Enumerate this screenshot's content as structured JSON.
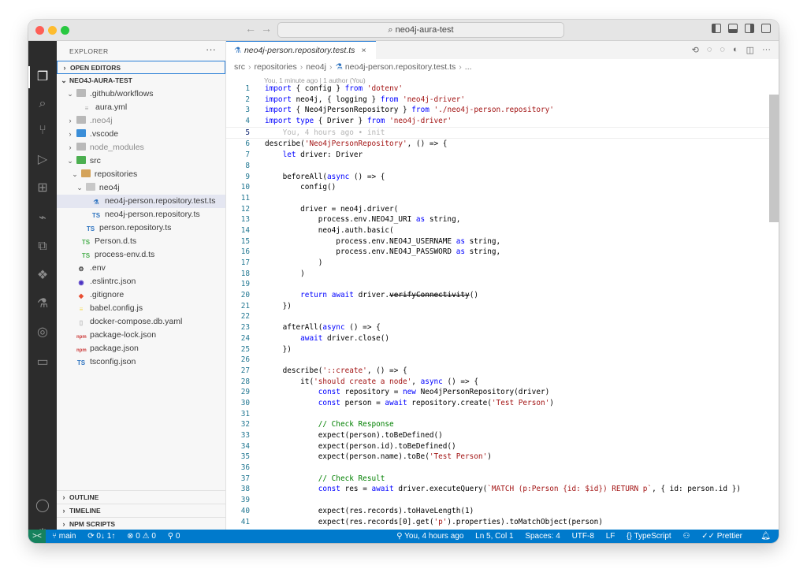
{
  "titlebar": {
    "search": "neo4j-aura-test",
    "back": "←",
    "forward": "→"
  },
  "sidebar": {
    "title": "EXPLORER",
    "more": "···",
    "open_editors": "OPEN EDITORS",
    "project": "NEO4J-AURA-TEST",
    "tree": [
      {
        "label": ".github/workflows",
        "type": "folder",
        "chev": "⌄"
      },
      {
        "label": "aura.yml",
        "type": "yml"
      },
      {
        "label": ".neo4j",
        "type": "folder",
        "chev": "›"
      },
      {
        "label": ".vscode",
        "type": "folder",
        "chev": "›"
      },
      {
        "label": "node_modules",
        "type": "folder",
        "chev": "›"
      },
      {
        "label": "src",
        "type": "folder",
        "chev": "⌄"
      },
      {
        "label": "repositories",
        "type": "folder",
        "chev": "⌄"
      },
      {
        "label": "neo4j",
        "type": "folder",
        "chev": "⌄"
      },
      {
        "label": "neo4j-person.repository.test.ts",
        "type": "test"
      },
      {
        "label": "neo4j-person.repository.ts",
        "type": "ts",
        "icon": "TS"
      },
      {
        "label": "person.repository.ts",
        "type": "ts",
        "icon": "TS"
      },
      {
        "label": "Person.d.ts",
        "type": "dts",
        "icon": "TS"
      },
      {
        "label": "process-env.d.ts",
        "type": "dts",
        "icon": "TS"
      },
      {
        "label": ".env",
        "type": "gear"
      },
      {
        "label": ".eslintrc.json",
        "type": "eslint"
      },
      {
        "label": ".gitignore",
        "type": "git"
      },
      {
        "label": "babel.config.js",
        "type": "babel"
      },
      {
        "label": "docker-compose.db.yaml",
        "type": "docker"
      },
      {
        "label": "package-lock.json",
        "type": "npm"
      },
      {
        "label": "package.json",
        "type": "npm"
      },
      {
        "label": "tsconfig.json",
        "type": "ts",
        "icon": "TS"
      }
    ],
    "outline": "OUTLINE",
    "timeline": "TIMELINE",
    "npm_scripts": "NPM SCRIPTS"
  },
  "activity": {
    "badge": "1"
  },
  "editor": {
    "tab": "neo4j-person.repository.test.ts",
    "breadcrumb": [
      "src",
      "repositories",
      "neo4j",
      "neo4j-person.repository.test.ts",
      "..."
    ],
    "blame": "You, 1 minute ago | 1 author (You)",
    "lines": [
      {
        "n": "1",
        "code": "import { config } from 'dotenv'"
      },
      {
        "n": "2",
        "code": "import neo4j, { logging } from 'neo4j-driver'"
      },
      {
        "n": "3",
        "code": "import { Neo4jPersonRepository } from './neo4j-person.repository'"
      },
      {
        "n": "4",
        "code": "import type { Driver } from 'neo4j-driver'"
      },
      {
        "n": "5",
        "code": "",
        "ghost": "    You, 4 hours ago • init"
      },
      {
        "n": "6",
        "code": "describe('Neo4jPersonRepository', () => {"
      },
      {
        "n": "7",
        "code": "    let driver: Driver"
      },
      {
        "n": "8",
        "code": ""
      },
      {
        "n": "9",
        "code": "    beforeAll(async () => {"
      },
      {
        "n": "10",
        "code": "        config()"
      },
      {
        "n": "11",
        "code": ""
      },
      {
        "n": "12",
        "code": "        driver = neo4j.driver("
      },
      {
        "n": "13",
        "code": "            process.env.NEO4J_URI as string,"
      },
      {
        "n": "14",
        "code": "            neo4j.auth.basic("
      },
      {
        "n": "15",
        "code": "                process.env.NEO4J_USERNAME as string,"
      },
      {
        "n": "16",
        "code": "                process.env.NEO4J_PASSWORD as string,"
      },
      {
        "n": "17",
        "code": "            )"
      },
      {
        "n": "18",
        "code": "        )"
      },
      {
        "n": "19",
        "code": ""
      },
      {
        "n": "20",
        "code": "        return await driver.verifyConnectivity()"
      },
      {
        "n": "21",
        "code": "    })"
      },
      {
        "n": "22",
        "code": ""
      },
      {
        "n": "23",
        "code": "    afterAll(async () => {"
      },
      {
        "n": "24",
        "code": "        await driver.close()"
      },
      {
        "n": "25",
        "code": "    })"
      },
      {
        "n": "26",
        "code": ""
      },
      {
        "n": "27",
        "code": "    describe('::create', () => {"
      },
      {
        "n": "28",
        "code": "        it('should create a node', async () => {"
      },
      {
        "n": "29",
        "code": "            const repository = new Neo4jPersonRepository(driver)"
      },
      {
        "n": "30",
        "code": "            const person = await repository.create('Test Person')"
      },
      {
        "n": "31",
        "code": ""
      },
      {
        "n": "32",
        "code": "            // Check Response"
      },
      {
        "n": "33",
        "code": "            expect(person).toBeDefined()"
      },
      {
        "n": "34",
        "code": "            expect(person.id).toBeDefined()"
      },
      {
        "n": "35",
        "code": "            expect(person.name).toBe('Test Person')"
      },
      {
        "n": "36",
        "code": ""
      },
      {
        "n": "37",
        "code": "            // Check Result"
      },
      {
        "n": "38",
        "code": "            const res = await driver.executeQuery(`MATCH (p:Person {id: $id}) RETURN p`, { id: person.id })"
      },
      {
        "n": "39",
        "code": ""
      },
      {
        "n": "40",
        "code": "            expect(res.records).toHaveLength(1)"
      },
      {
        "n": "41",
        "code": "            expect(res.records[0].get('p').properties).toMatchObject(person)"
      }
    ]
  },
  "statusbar": {
    "remote": "><",
    "branch": "main",
    "sync": "0↓ 1↑",
    "problems": "⊗ 0 ⚠ 0",
    "ports": "0",
    "blame": "You, 4 hours ago",
    "position": "Ln 5, Col 1",
    "spaces": "Spaces: 4",
    "encoding": "UTF-8",
    "eol": "LF",
    "language": "TypeScript",
    "prettier": "Prettier"
  }
}
